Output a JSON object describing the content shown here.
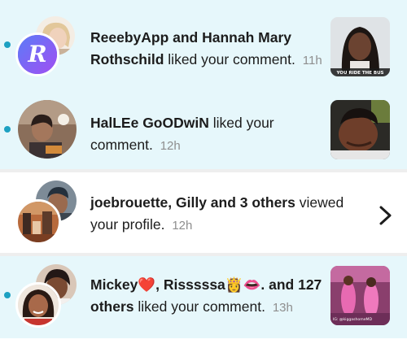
{
  "notifications": [
    {
      "unread": true,
      "actors": "ReeebyApp and Hannah Mary Rothschild",
      "action": "liked your comment.",
      "time": "11h",
      "app_badge_letter": "R",
      "thumbnail_caption": "YOU RIDE THE BUS",
      "trailing": "thumbnail"
    },
    {
      "unread": true,
      "actors": "HalLEe GoODwiN",
      "action": "liked your comment.",
      "time": "12h",
      "trailing": "thumbnail"
    },
    {
      "unread": false,
      "actors": "joebrouette, Gilly and 3 others",
      "action": "viewed your profile.",
      "time": "12h",
      "trailing": "chevron"
    },
    {
      "unread": true,
      "actors_part1": "Mickey",
      "actors_part2": ", Risssssa",
      "actors_part3": ". and 127 others",
      "action": "liked your comment.",
      "time": "13h",
      "emoji_heart": "❤️",
      "emoji_crown": "👸",
      "emoji_lips": "👄",
      "thumbnail_caption": "IG: @kiggashomeMD",
      "trailing": "thumbnail"
    }
  ],
  "colors": {
    "unread_bg": "#e6f7fb",
    "unread_dot": "#1da1c2",
    "time_text": "#8e8e8e"
  }
}
